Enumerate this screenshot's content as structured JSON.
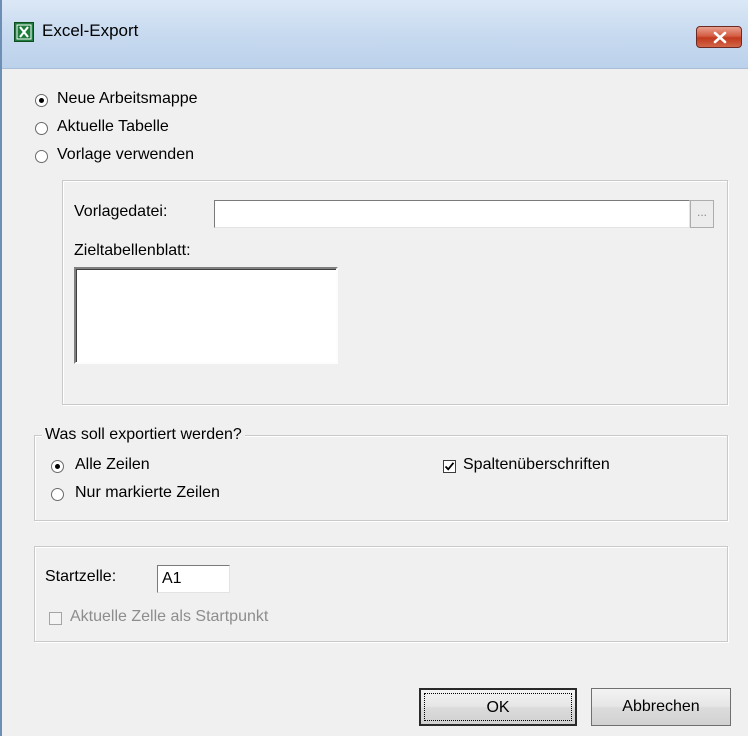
{
  "window": {
    "title": "Excel-Export",
    "title_icon": "excel-icon",
    "close_icon": "close-icon"
  },
  "mode": {
    "options": [
      "Neue Arbeitsmappe",
      "Aktuelle Tabelle",
      "Vorlage verwenden"
    ],
    "selected": 0
  },
  "template": {
    "file_label": "Vorlagedatei:",
    "file_value": "",
    "browse_label": "...",
    "sheet_label": "Zieltabellenblatt:"
  },
  "export": {
    "legend": "Was soll exportiert werden?",
    "rows_options": [
      "Alle Zeilen",
      "Nur markierte Zeilen"
    ],
    "rows_selected": 0,
    "headers_label": "Spaltenüberschriften",
    "headers_checked": true
  },
  "start": {
    "cell_label": "Startzelle:",
    "cell_value": "A1",
    "use_current_label": "Aktuelle Zelle als Startpunkt",
    "use_current_checked": false
  },
  "buttons": {
    "ok": "OK",
    "cancel": "Abbrechen"
  }
}
